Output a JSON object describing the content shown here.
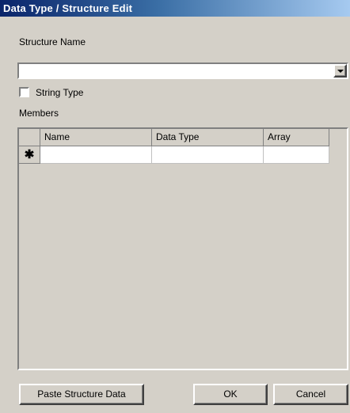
{
  "window": {
    "title": "Data Type / Structure Edit"
  },
  "structure_name": {
    "label": "Structure Name",
    "value": ""
  },
  "string_type": {
    "label": "String Type",
    "checked": false
  },
  "members": {
    "label": "Members",
    "columns": [
      "Name",
      "Data Type",
      "Array"
    ],
    "new_row_marker": "✱"
  },
  "buttons": {
    "paste": "Paste Structure Data",
    "ok": "OK",
    "cancel": "Cancel"
  },
  "colors": {
    "titlebar_start": "#0a246a",
    "titlebar_end": "#a6caf0",
    "face": "#d4d0c8"
  }
}
